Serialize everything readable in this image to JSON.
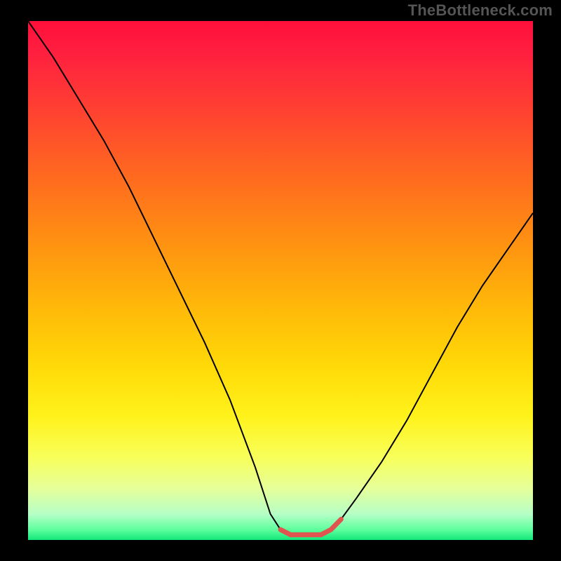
{
  "watermark": "TheBottleneck.com",
  "chart_data": {
    "type": "line",
    "title": "",
    "xlabel": "",
    "ylabel": "",
    "xlim": [
      0,
      100
    ],
    "ylim": [
      0,
      100
    ],
    "grid": false,
    "legend": false,
    "series": [
      {
        "name": "bottleneck-curve",
        "x": [
          0,
          5,
          10,
          15,
          20,
          25,
          30,
          35,
          40,
          45,
          48,
          50,
          52,
          55,
          58,
          60,
          62,
          65,
          70,
          75,
          80,
          85,
          90,
          95,
          100
        ],
        "y": [
          100,
          93,
          85,
          77,
          68,
          58,
          48,
          38,
          27,
          14,
          5,
          2,
          1,
          1,
          1,
          2,
          4,
          8,
          15,
          23,
          32,
          41,
          49,
          56,
          63
        ]
      }
    ],
    "valley_highlight": {
      "name": "optimal-range",
      "color": "#e0554f",
      "x": [
        50,
        52,
        55,
        58,
        60,
        62
      ],
      "y": [
        2,
        1,
        1,
        1,
        2,
        4
      ]
    },
    "background_gradient": {
      "orientation": "vertical",
      "stops": [
        {
          "pos": 0.0,
          "color": "#ff0f3a"
        },
        {
          "pos": 0.3,
          "color": "#ff6a1f"
        },
        {
          "pos": 0.66,
          "color": "#ffd807"
        },
        {
          "pos": 0.9,
          "color": "#e6ff99"
        },
        {
          "pos": 1.0,
          "color": "#12e87a"
        }
      ]
    }
  }
}
